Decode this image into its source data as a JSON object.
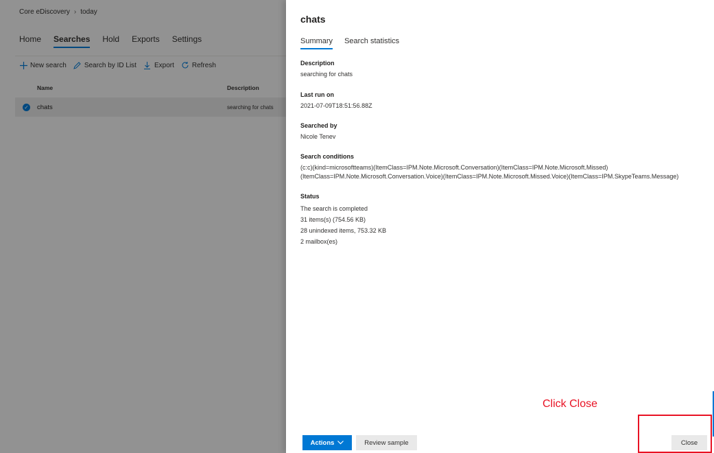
{
  "breadcrumb": {
    "root": "Core eDiscovery",
    "current": "today"
  },
  "nav": {
    "tabs": [
      "Home",
      "Searches",
      "Hold",
      "Exports",
      "Settings"
    ],
    "active": "Searches"
  },
  "toolbar": {
    "new_search": "New search",
    "search_by_id": "Search by ID List",
    "export": "Export",
    "refresh": "Refresh"
  },
  "table": {
    "headers": {
      "name": "Name",
      "description": "Description"
    },
    "rows": [
      {
        "name": "chats",
        "description": "searching for chats"
      }
    ]
  },
  "panel": {
    "title": "chats",
    "tabs": [
      "Summary",
      "Search statistics"
    ],
    "description": {
      "label": "Description",
      "value": "searching for chats"
    },
    "last_run": {
      "label": "Last run on",
      "value": "2021-07-09T18:51:56.88Z"
    },
    "searched_by": {
      "label": "Searched by",
      "value": "Nicole Tenev"
    },
    "conditions": {
      "label": "Search conditions",
      "line1": "(c:c)(kind=microsoftteams)(ItemClass=IPM.Note.Microsoft.Conversation)(ItemClass=IPM.Note.Microsoft.Missed)",
      "line2": "(ItemClass=IPM.Note.Microsoft.Conversation.Voice)(ItemClass=IPM.Note.Microsoft.Missed.Voice)(ItemClass=IPM.SkypeTeams.Message)"
    },
    "status": {
      "label": "Status",
      "lines": [
        "The search is completed",
        "31 items(s) (754.56 KB)",
        "28 unindexed items, 753.32 KB",
        "2 mailbox(es)"
      ]
    }
  },
  "footer": {
    "actions": "Actions",
    "review_sample": "Review sample",
    "close": "Close"
  },
  "annotation": {
    "text": "Click Close",
    "color": "#e81123"
  },
  "colors": {
    "accent": "#0078d4"
  }
}
